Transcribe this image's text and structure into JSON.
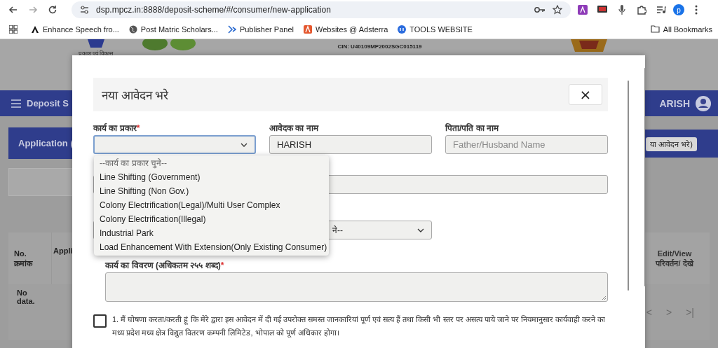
{
  "browser": {
    "url": "dsp.mpcz.in:8888/deposit-scheme/#/consumer/new-application",
    "bookmarks": [
      {
        "label": "Enhance Speech fro...",
        "kind": "letter"
      },
      {
        "label": "Post Matric Scholars...",
        "kind": "globe"
      },
      {
        "label": "Publisher Panel",
        "kind": "chevrons"
      },
      {
        "label": "Websites @ Adsterra",
        "kind": "square"
      },
      {
        "label": "TOOLS WEBSITE",
        "kind": "circle"
      }
    ],
    "all_bookmarks": "All Bookmarks",
    "profile": "p"
  },
  "page": {
    "logo_caption": "प्रकाश एवं विकास",
    "cin": "CIN: U40109MP2002SGC015119",
    "navbar_title": "Deposit S",
    "user": "ARISH",
    "application_button": "Application (",
    "new_application_button": "या आवेदन भरे)",
    "table": {
      "columns": [
        "No. क्रमांक",
        "Appli",
        "Edit/View परिवर्तन/ देखे"
      ],
      "empty": "No data."
    },
    "pagination": [
      "<",
      ">",
      ">|"
    ]
  },
  "modal": {
    "title": "नया आवेदन भरे",
    "close": "×",
    "fields": [
      {
        "kind": "select",
        "label": "कार्य का प्रकार",
        "required_mark": "*"
      },
      {
        "kind": "input",
        "label": "आवेदक का नाम",
        "value": "HARISH"
      },
      {
        "kind": "input",
        "label": "पिता/पति का नाम",
        "placeholder": "Father/Husband Name"
      }
    ],
    "second_row_field": {
      "kind": "input"
    },
    "third_row_select": {
      "value": "ने--"
    },
    "description": {
      "label": "कार्य का विवरण (अधिकतम २५५ शब्द)",
      "required_mark": "*"
    },
    "declaration": {
      "checked": false,
      "text": "1. मैं घोषणा करता/करती हूं कि मेरे द्वारा इस आवेदन में दी गई उपरोक्त समस्त जानकारियां पूर्ण एवं सत्य हैं तथा किसी भी स्तर पर असत्य पाये जाने पर नियमानुसार कार्यवाही करने का मध्य प्रदेश मध्य क्षेत्र विद्युत वितरण कम्पनी लिमिटेड, भोपाल को पूर्ण अधिकार होगा।"
    },
    "dropdown": {
      "options": [
        {
          "label": "--कार्य का प्रकार चुने--",
          "kind": "placeholder",
          "selected": false
        },
        {
          "label": "Line Shifting (Government)",
          "kind": "option",
          "selected": false
        },
        {
          "label": "Line Shifting (Non Gov.)",
          "kind": "option",
          "selected": false
        },
        {
          "label": "Colony Electrification(Legal)/Multi User Complex",
          "kind": "option",
          "selected": false
        },
        {
          "label": "Colony Electrification(Illegal)",
          "kind": "option",
          "selected": false
        },
        {
          "label": "Industrial Park",
          "kind": "option",
          "selected": false
        },
        {
          "label": "Load Enhancement With Extension(Only Existing Consumer)",
          "kind": "option",
          "selected": false
        }
      ]
    }
  }
}
